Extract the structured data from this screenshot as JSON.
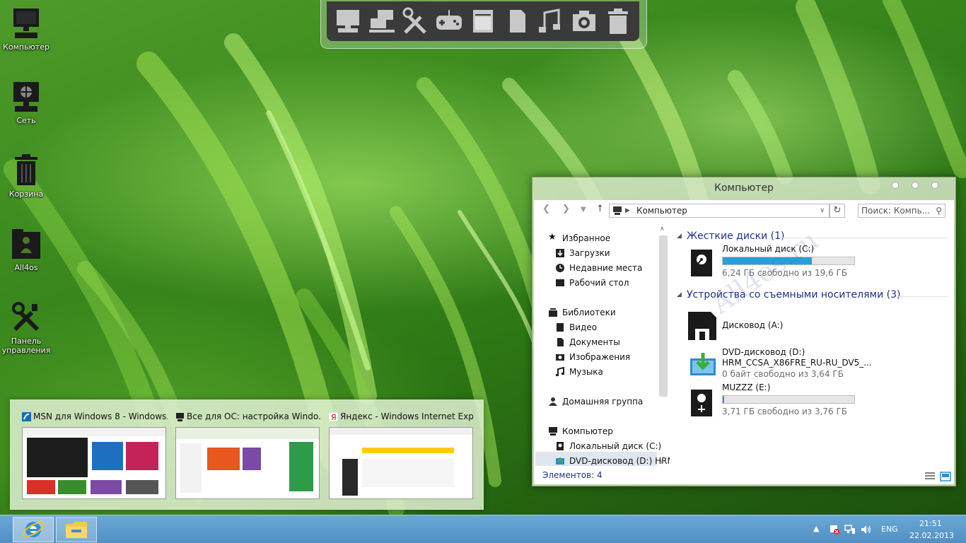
{
  "desktop_icons": [
    {
      "label": "Компьютер",
      "icon": "computer-icon"
    },
    {
      "label": "Сеть",
      "icon": "network-icon"
    },
    {
      "label": "Корзина",
      "icon": "recycle-bin-icon"
    },
    {
      "label": "All4os",
      "icon": "folder-user-icon"
    },
    {
      "label": "Панель управления",
      "icon": "control-panel-icon"
    }
  ],
  "dock": {
    "items": [
      "computer-icon",
      "network-icon",
      "tools-icon",
      "gamepad-icon",
      "window-icon",
      "document-icon",
      "music-icon",
      "camera-icon",
      "trash-icon"
    ]
  },
  "explorer": {
    "title": "Компьютер",
    "address": "Компьютер",
    "search_placeholder": "Поиск: Компь...",
    "nav": {
      "favorites": "Избранное",
      "downloads": "Загрузки",
      "recent": "Недавние места",
      "desktop": "Рабочий стол",
      "libraries": "Библиотеки",
      "video": "Видео",
      "documents": "Документы",
      "images": "Изображения",
      "music": "Музыка",
      "homegroup": "Домашняя группа",
      "computer": "Компьютер",
      "local_disk": "Локальный диск (C:)",
      "dvd": "DVD-дисковод (D:) HRM"
    },
    "groups": {
      "hdd": "Жесткие диски (1)",
      "removable": "Устройства со съемными носителями (3)"
    },
    "drives": [
      {
        "name": "Локальный диск (C:)",
        "free": "6,24 ГБ свободно из 19,6 ГБ",
        "used_fraction": 0.68
      },
      {
        "name": "Дисковод (A:)"
      },
      {
        "name": "DVD-дисковод (D:)",
        "label": "HRM_CCSA_X86FRE_RU-RU_DV5_...",
        "free": "0 байт свободно из 3,64 ГБ"
      },
      {
        "name": "MUZZZ (E:)",
        "free": "3,71 ГБ свободно из 3,76 ГБ",
        "used_fraction": 0.013
      }
    ],
    "status": "Элементов: 4"
  },
  "watermark": "All4os.ru",
  "previews": [
    {
      "title": "MSN для Windows 8 - Windows..."
    },
    {
      "title": "Все для ОС: настройка Windo..."
    },
    {
      "title": "Яндекс - Windows Internet Expl..."
    }
  ],
  "tray": {
    "lang": "ENG",
    "time": "21:51",
    "date": "22.02.2013"
  },
  "colors": {
    "accent_blue": "#1e3287",
    "progress": "#26a0da",
    "taskbar": "#5b9bcc"
  }
}
